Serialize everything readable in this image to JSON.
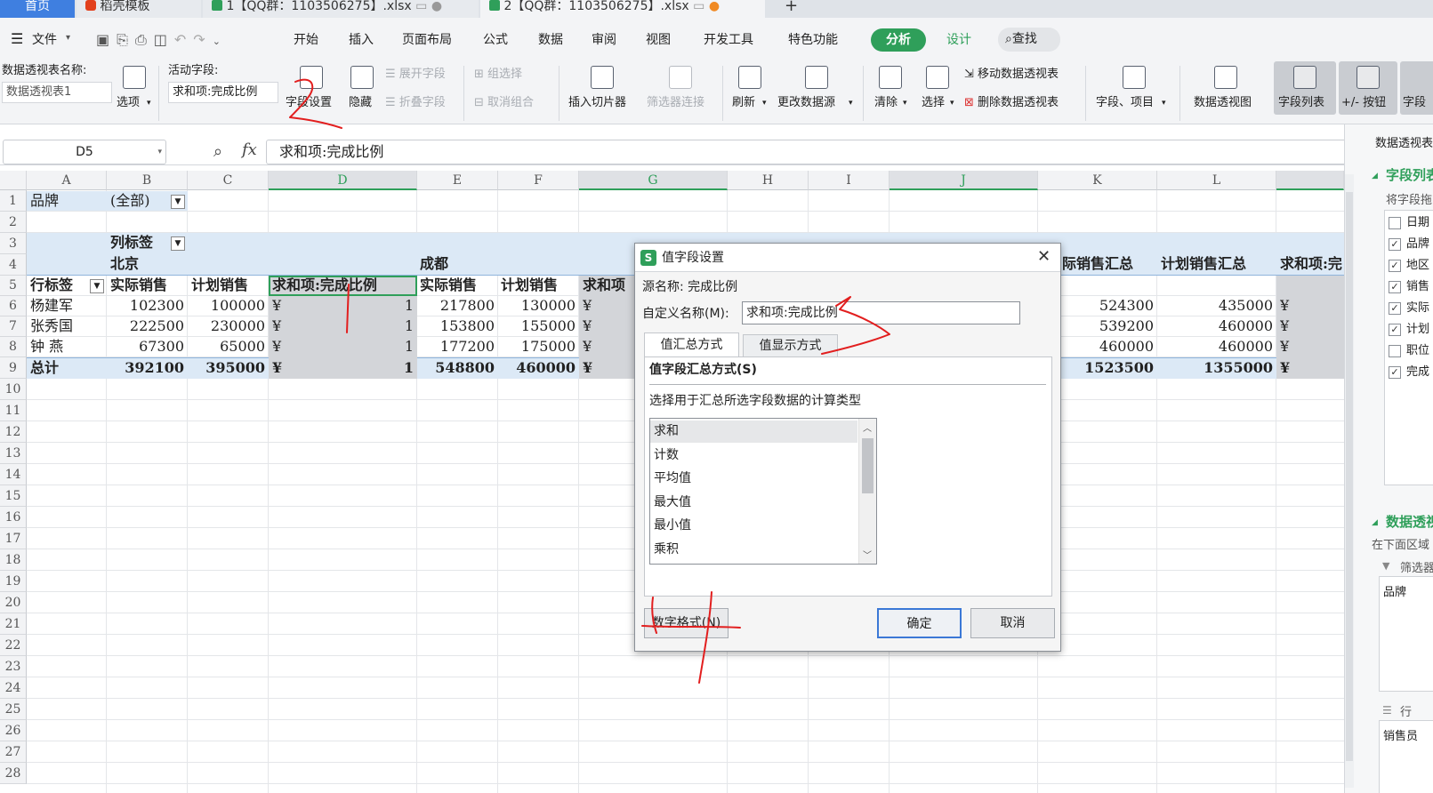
{
  "tabs": [
    {
      "label": "首页",
      "active": false
    },
    {
      "label": "稻壳模板",
      "active": false
    },
    {
      "label": "1【QQ群：1103506275】.xlsx",
      "active": false
    },
    {
      "label": "2【QQ群：1103506275】.xlsx",
      "active": true
    }
  ],
  "menu": {
    "file": "文件",
    "items": [
      "开始",
      "插入",
      "页面布局",
      "公式",
      "数据",
      "审阅",
      "视图",
      "开发工具",
      "特色功能"
    ],
    "analyze": "分析",
    "design": "设计",
    "search": "查找"
  },
  "ribbon": {
    "pt_name_label": "数据透视表名称:",
    "pt_name_value": "数据透视表1",
    "options": "选项",
    "active_field_label": "活动字段:",
    "active_field_value": "求和项:完成比例",
    "field_settings": "字段设置",
    "hide": "隐藏",
    "expand_field": "展开字段",
    "collapse_field": "折叠字段",
    "group_selection": "组选择",
    "ungroup": "取消组合",
    "insert_slicer": "插入切片器",
    "filter_connections": "筛选器连接",
    "refresh": "刷新",
    "change_source": "更改数据源",
    "clear": "清除",
    "select": "选择",
    "move_pt": "移动数据透视表",
    "delete_pt": "删除数据透视表",
    "fields_items": "字段、项目",
    "pivot_chart": "数据透视图",
    "field_list": "字段列表",
    "plus_minus": "+/- 按钮",
    "field_headers": "字段"
  },
  "formula_bar": {
    "name_box": "D5",
    "fx": "fx",
    "content": "求和项:完成比例"
  },
  "sheet": {
    "columns": [
      "A",
      "B",
      "C",
      "D",
      "E",
      "F",
      "G",
      "H",
      "I",
      "J",
      "K",
      "L"
    ],
    "rows": [
      "1",
      "2",
      "3",
      "4",
      "5",
      "6",
      "7",
      "8",
      "9",
      "10",
      "11",
      "12",
      "13",
      "14",
      "15",
      "16",
      "17",
      "18",
      "19",
      "20",
      "21",
      "22",
      "23",
      "24",
      "25",
      "26",
      "27",
      "28"
    ],
    "brand_label": "品牌",
    "brand_value": "(全部)",
    "col_labels": "列标签",
    "beijing": "北京",
    "chengdu": "成都",
    "row_labels": "行标签",
    "h_actual": "实际销售",
    "h_plan": "计划销售",
    "h_ratio": "求和项:完成比例",
    "h_ratio_short": "求和项",
    "h_actual_total": "际销售汇总",
    "h_plan_total": "计划销售汇总",
    "h_ratio_total": "求和项:完",
    "yen": "¥",
    "data_rows": [
      {
        "name": "杨建军",
        "b": "102300",
        "c": "100000",
        "d": "1",
        "e": "217800",
        "f": "130000",
        "k": "524300",
        "l": "435000"
      },
      {
        "name": "张秀国",
        "b": "222500",
        "c": "230000",
        "d": "1",
        "e": "153800",
        "f": "155000",
        "k": "539200",
        "l": "460000"
      },
      {
        "name": "钟  燕",
        "b": "67300",
        "c": "65000",
        "d": "1",
        "e": "177200",
        "f": "175000",
        "k": "460000",
        "l": "460000"
      }
    ],
    "total": {
      "name": "总计",
      "b": "392100",
      "c": "395000",
      "d": "1",
      "e": "548800",
      "f": "460000",
      "k": "1523500",
      "l": "1355000"
    }
  },
  "dialog": {
    "title": "值字段设置",
    "source_label": "源名称: ",
    "source_value": "完成比例",
    "custom_name_label": "自定义名称(M):",
    "custom_name_value": "求和项:完成比例",
    "tab_summarize": "值汇总方式",
    "tab_show_as": "值显示方式",
    "section_title": "值字段汇总方式(S)",
    "instruction": "选择用于汇总所选字段数据的计算类型",
    "functions": [
      "求和",
      "计数",
      "平均值",
      "最大值",
      "最小值",
      "乘积"
    ],
    "number_format": "数字格式(N)",
    "ok": "确定",
    "cancel": "取消"
  },
  "right_panel": {
    "title": "数据透视表",
    "field_list_header": "字段列表",
    "drag_hint": "将字段拖",
    "fields": [
      {
        "label": "日期",
        "checked": false
      },
      {
        "label": "品牌",
        "checked": true
      },
      {
        "label": "地区",
        "checked": true
      },
      {
        "label": "销售",
        "checked": true
      },
      {
        "label": "实际",
        "checked": true
      },
      {
        "label": "计划",
        "checked": true
      },
      {
        "label": "职位",
        "checked": false
      },
      {
        "label": "完成",
        "checked": true
      }
    ],
    "areas_header": "数据透视",
    "areas_hint": "在下面区域",
    "filter_label": "筛选器",
    "filter_value": "品牌",
    "rows_label": "行",
    "rows_value": "销售员"
  },
  "colors": {
    "accent_green": "#2f9f5a",
    "selection_gray": "#d3d5d9",
    "pivot_header_blue": "#dce9f6",
    "annotation_red": "#e21e1e"
  }
}
